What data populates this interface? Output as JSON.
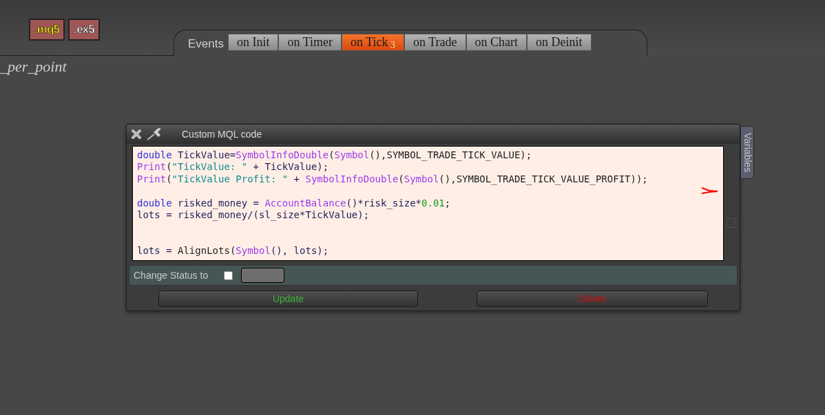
{
  "file_buttons": [
    {
      "label": ".mq5",
      "kind": "source"
    },
    {
      "label": ".ex5",
      "kind": "compiled"
    }
  ],
  "events": {
    "label": "Events",
    "tabs": [
      {
        "label": "on Init",
        "selected": false
      },
      {
        "label": "on Timer",
        "selected": false
      },
      {
        "label": "on Tick",
        "badge": "3",
        "selected": true
      },
      {
        "label": "on Trade",
        "selected": false
      },
      {
        "label": "on Chart",
        "selected": false
      },
      {
        "label": "on Deinit",
        "selected": false
      }
    ]
  },
  "background_text": "_per_point",
  "dialog": {
    "title": "Custom MQL code",
    "side_tab": "Variables",
    "code_lines": [
      {
        "kind": "code",
        "tokens": [
          {
            "kind": "keyword",
            "text": "double"
          },
          {
            "kind": "identifier",
            "text": " TickValue="
          },
          {
            "kind": "function",
            "text": "SymbolInfoDouble"
          },
          {
            "kind": "plain",
            "text": "("
          },
          {
            "kind": "function",
            "text": "Symbol"
          },
          {
            "kind": "plain",
            "text": "(),SYMBOL_TRADE_TICK_VALUE);"
          }
        ]
      },
      {
        "kind": "code",
        "tokens": [
          {
            "kind": "function",
            "text": "Print"
          },
          {
            "kind": "plain",
            "text": "("
          },
          {
            "kind": "string",
            "text": "\"TickValue: \""
          },
          {
            "kind": "identifier",
            "text": " + TickValue);"
          }
        ]
      },
      {
        "kind": "code",
        "tokens": [
          {
            "kind": "function",
            "text": "Print"
          },
          {
            "kind": "plain",
            "text": "("
          },
          {
            "kind": "string",
            "text": "\"TickValue Profit: \""
          },
          {
            "kind": "identifier",
            "text": " + "
          },
          {
            "kind": "function",
            "text": "SymbolInfoDouble"
          },
          {
            "kind": "plain",
            "text": "("
          },
          {
            "kind": "function",
            "text": "Symbol"
          },
          {
            "kind": "plain",
            "text": "(),SYMBOL_TRADE_TICK_VALUE_PROFIT));"
          }
        ]
      },
      {
        "kind": "blank"
      },
      {
        "kind": "code",
        "tokens": [
          {
            "kind": "keyword",
            "text": "double"
          },
          {
            "kind": "identifier",
            "text": " risked_money = "
          },
          {
            "kind": "function",
            "text": "AccountBalance"
          },
          {
            "kind": "identifier",
            "text": "()*risk_size*"
          },
          {
            "kind": "number",
            "text": "0.01"
          },
          {
            "kind": "plain",
            "text": ";"
          }
        ]
      },
      {
        "kind": "code",
        "tokens": [
          {
            "kind": "identifier",
            "text": "lots = risked_money/(sl_size*TickValue);"
          }
        ]
      },
      {
        "kind": "blank"
      },
      {
        "kind": "blank"
      },
      {
        "kind": "code",
        "tokens": [
          {
            "kind": "identifier",
            "text": "lots = "
          },
          {
            "kind": "plain",
            "text": "AlignLots"
          },
          {
            "kind": "plain",
            "text": "("
          },
          {
            "kind": "function",
            "text": "Symbol"
          },
          {
            "kind": "identifier",
            "text": "(), lots);"
          }
        ]
      }
    ],
    "status_label": "Change Status to",
    "status_checked": false,
    "buttons": [
      {
        "label": "Update",
        "kind": "update"
      },
      {
        "label": "Delete",
        "kind": "delete"
      }
    ]
  }
}
